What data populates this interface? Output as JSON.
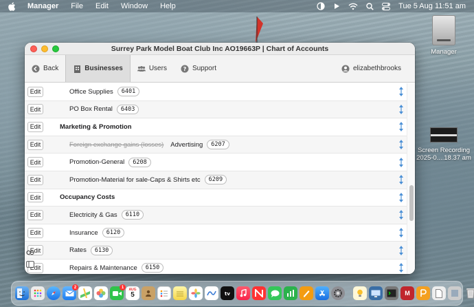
{
  "menubar": {
    "app_name": "Manager",
    "menus": [
      "File",
      "Edit",
      "Window",
      "Help"
    ],
    "date_time": "Tue 5 Aug  11:51 am"
  },
  "desktop": {
    "drive_label": "Manager",
    "recording_label_1": "Screen Recording",
    "recording_label_2": "2025-0....18.37 am"
  },
  "window": {
    "title": "Surrey Park Model Boat Club Inc AO19663P | Chart of Accounts",
    "toolbar": {
      "back": "Back",
      "businesses": "Businesses",
      "users": "Users",
      "support": "Support",
      "user": "elizabethbrooks"
    }
  },
  "accounts": {
    "edit_label": "Edit",
    "rows": [
      {
        "type": "account",
        "name": "Office Supplies",
        "code": "6401"
      },
      {
        "type": "account",
        "name": "PO Box Rental",
        "code": "6403"
      },
      {
        "type": "header",
        "name": "Marketing & Promotion"
      },
      {
        "type": "account",
        "name": "Advertising",
        "code": "6207",
        "struck": "Foreign exchange gains (losses)"
      },
      {
        "type": "account",
        "name": "Promotion-General",
        "code": "6208"
      },
      {
        "type": "account",
        "name": "Promotion-Material for sale-Caps & Shirts etc",
        "code": "6209"
      },
      {
        "type": "header",
        "name": "Occupancy Costs"
      },
      {
        "type": "account",
        "name": "Electricity & Gas",
        "code": "6110"
      },
      {
        "type": "account",
        "name": "Insurance",
        "code": "6120"
      },
      {
        "type": "account",
        "name": "Rates",
        "code": "6130"
      },
      {
        "type": "account",
        "name": "Repairs & Maintenance",
        "code": "6150"
      }
    ]
  },
  "dock": {
    "calendar_day": "5",
    "calendar_month": "AUG",
    "mail_badge": "2",
    "facetime_badge": "1",
    "manager_letter": "M"
  },
  "colors": {
    "accent_blue": "#4a8fd6",
    "close": "#fe5f57",
    "minimize": "#febc2e",
    "maximize": "#28c840"
  }
}
